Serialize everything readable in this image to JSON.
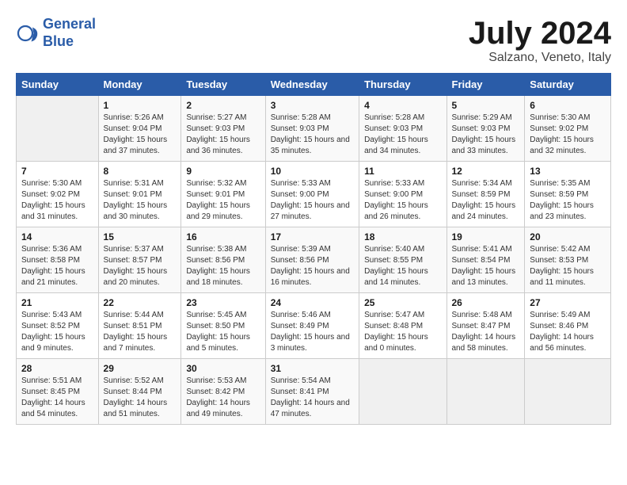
{
  "logo": {
    "text_general": "General",
    "text_blue": "Blue"
  },
  "title": "July 2024",
  "subtitle": "Salzano, Veneto, Italy",
  "weekdays": [
    "Sunday",
    "Monday",
    "Tuesday",
    "Wednesday",
    "Thursday",
    "Friday",
    "Saturday"
  ],
  "weeks": [
    [
      {
        "day": "",
        "sunrise": "",
        "sunset": "",
        "daylight": ""
      },
      {
        "day": "1",
        "sunrise": "Sunrise: 5:26 AM",
        "sunset": "Sunset: 9:04 PM",
        "daylight": "Daylight: 15 hours and 37 minutes."
      },
      {
        "day": "2",
        "sunrise": "Sunrise: 5:27 AM",
        "sunset": "Sunset: 9:03 PM",
        "daylight": "Daylight: 15 hours and 36 minutes."
      },
      {
        "day": "3",
        "sunrise": "Sunrise: 5:28 AM",
        "sunset": "Sunset: 9:03 PM",
        "daylight": "Daylight: 15 hours and 35 minutes."
      },
      {
        "day": "4",
        "sunrise": "Sunrise: 5:28 AM",
        "sunset": "Sunset: 9:03 PM",
        "daylight": "Daylight: 15 hours and 34 minutes."
      },
      {
        "day": "5",
        "sunrise": "Sunrise: 5:29 AM",
        "sunset": "Sunset: 9:03 PM",
        "daylight": "Daylight: 15 hours and 33 minutes."
      },
      {
        "day": "6",
        "sunrise": "Sunrise: 5:30 AM",
        "sunset": "Sunset: 9:02 PM",
        "daylight": "Daylight: 15 hours and 32 minutes."
      }
    ],
    [
      {
        "day": "7",
        "sunrise": "Sunrise: 5:30 AM",
        "sunset": "Sunset: 9:02 PM",
        "daylight": "Daylight: 15 hours and 31 minutes."
      },
      {
        "day": "8",
        "sunrise": "Sunrise: 5:31 AM",
        "sunset": "Sunset: 9:01 PM",
        "daylight": "Daylight: 15 hours and 30 minutes."
      },
      {
        "day": "9",
        "sunrise": "Sunrise: 5:32 AM",
        "sunset": "Sunset: 9:01 PM",
        "daylight": "Daylight: 15 hours and 29 minutes."
      },
      {
        "day": "10",
        "sunrise": "Sunrise: 5:33 AM",
        "sunset": "Sunset: 9:00 PM",
        "daylight": "Daylight: 15 hours and 27 minutes."
      },
      {
        "day": "11",
        "sunrise": "Sunrise: 5:33 AM",
        "sunset": "Sunset: 9:00 PM",
        "daylight": "Daylight: 15 hours and 26 minutes."
      },
      {
        "day": "12",
        "sunrise": "Sunrise: 5:34 AM",
        "sunset": "Sunset: 8:59 PM",
        "daylight": "Daylight: 15 hours and 24 minutes."
      },
      {
        "day": "13",
        "sunrise": "Sunrise: 5:35 AM",
        "sunset": "Sunset: 8:59 PM",
        "daylight": "Daylight: 15 hours and 23 minutes."
      }
    ],
    [
      {
        "day": "14",
        "sunrise": "Sunrise: 5:36 AM",
        "sunset": "Sunset: 8:58 PM",
        "daylight": "Daylight: 15 hours and 21 minutes."
      },
      {
        "day": "15",
        "sunrise": "Sunrise: 5:37 AM",
        "sunset": "Sunset: 8:57 PM",
        "daylight": "Daylight: 15 hours and 20 minutes."
      },
      {
        "day": "16",
        "sunrise": "Sunrise: 5:38 AM",
        "sunset": "Sunset: 8:56 PM",
        "daylight": "Daylight: 15 hours and 18 minutes."
      },
      {
        "day": "17",
        "sunrise": "Sunrise: 5:39 AM",
        "sunset": "Sunset: 8:56 PM",
        "daylight": "Daylight: 15 hours and 16 minutes."
      },
      {
        "day": "18",
        "sunrise": "Sunrise: 5:40 AM",
        "sunset": "Sunset: 8:55 PM",
        "daylight": "Daylight: 15 hours and 14 minutes."
      },
      {
        "day": "19",
        "sunrise": "Sunrise: 5:41 AM",
        "sunset": "Sunset: 8:54 PM",
        "daylight": "Daylight: 15 hours and 13 minutes."
      },
      {
        "day": "20",
        "sunrise": "Sunrise: 5:42 AM",
        "sunset": "Sunset: 8:53 PM",
        "daylight": "Daylight: 15 hours and 11 minutes."
      }
    ],
    [
      {
        "day": "21",
        "sunrise": "Sunrise: 5:43 AM",
        "sunset": "Sunset: 8:52 PM",
        "daylight": "Daylight: 15 hours and 9 minutes."
      },
      {
        "day": "22",
        "sunrise": "Sunrise: 5:44 AM",
        "sunset": "Sunset: 8:51 PM",
        "daylight": "Daylight: 15 hours and 7 minutes."
      },
      {
        "day": "23",
        "sunrise": "Sunrise: 5:45 AM",
        "sunset": "Sunset: 8:50 PM",
        "daylight": "Daylight: 15 hours and 5 minutes."
      },
      {
        "day": "24",
        "sunrise": "Sunrise: 5:46 AM",
        "sunset": "Sunset: 8:49 PM",
        "daylight": "Daylight: 15 hours and 3 minutes."
      },
      {
        "day": "25",
        "sunrise": "Sunrise: 5:47 AM",
        "sunset": "Sunset: 8:48 PM",
        "daylight": "Daylight: 15 hours and 0 minutes."
      },
      {
        "day": "26",
        "sunrise": "Sunrise: 5:48 AM",
        "sunset": "Sunset: 8:47 PM",
        "daylight": "Daylight: 14 hours and 58 minutes."
      },
      {
        "day": "27",
        "sunrise": "Sunrise: 5:49 AM",
        "sunset": "Sunset: 8:46 PM",
        "daylight": "Daylight: 14 hours and 56 minutes."
      }
    ],
    [
      {
        "day": "28",
        "sunrise": "Sunrise: 5:51 AM",
        "sunset": "Sunset: 8:45 PM",
        "daylight": "Daylight: 14 hours and 54 minutes."
      },
      {
        "day": "29",
        "sunrise": "Sunrise: 5:52 AM",
        "sunset": "Sunset: 8:44 PM",
        "daylight": "Daylight: 14 hours and 51 minutes."
      },
      {
        "day": "30",
        "sunrise": "Sunrise: 5:53 AM",
        "sunset": "Sunset: 8:42 PM",
        "daylight": "Daylight: 14 hours and 49 minutes."
      },
      {
        "day": "31",
        "sunrise": "Sunrise: 5:54 AM",
        "sunset": "Sunset: 8:41 PM",
        "daylight": "Daylight: 14 hours and 47 minutes."
      },
      {
        "day": "",
        "sunrise": "",
        "sunset": "",
        "daylight": ""
      },
      {
        "day": "",
        "sunrise": "",
        "sunset": "",
        "daylight": ""
      },
      {
        "day": "",
        "sunrise": "",
        "sunset": "",
        "daylight": ""
      }
    ]
  ]
}
